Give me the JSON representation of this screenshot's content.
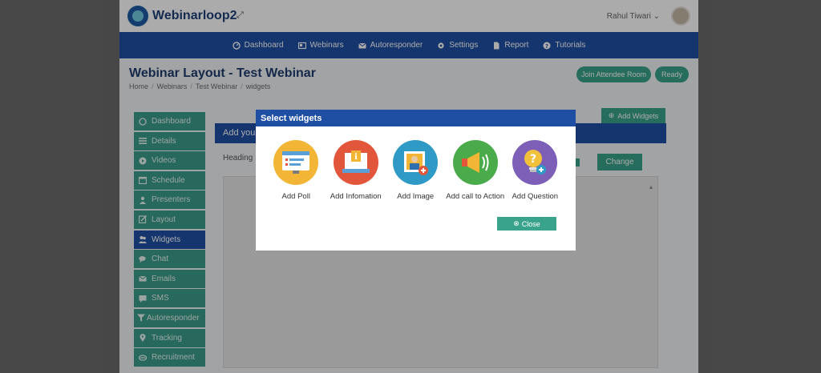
{
  "brand": {
    "name": "Webinarloop2"
  },
  "user": {
    "name": "Rahul Tiwari"
  },
  "nav": {
    "items": [
      {
        "label": "Dashboard",
        "icon": "dashboard-icon"
      },
      {
        "label": "Webinars",
        "icon": "webinars-icon"
      },
      {
        "label": "Autoresponder",
        "icon": "mail-icon"
      },
      {
        "label": "Settings",
        "icon": "gear-icon"
      },
      {
        "label": "Report",
        "icon": "report-icon"
      },
      {
        "label": "Tutorials",
        "icon": "help-icon"
      }
    ]
  },
  "page": {
    "title": "Webinar Layout - Test Webinar",
    "breadcrumb": [
      "Home",
      "Webinars",
      "Test Webinar",
      "widgets"
    ],
    "join_label": "Join Attendee Room",
    "ready_label": "Ready"
  },
  "sidebar": {
    "items": [
      {
        "label": "Dashboard",
        "icon": "dashboard-icon",
        "active": false
      },
      {
        "label": "Details",
        "icon": "list-icon",
        "active": false
      },
      {
        "label": "Videos",
        "icon": "video-icon",
        "active": false
      },
      {
        "label": "Schedule",
        "icon": "calendar-icon",
        "active": false
      },
      {
        "label": "Presenters",
        "icon": "user-icon",
        "active": false
      },
      {
        "label": "Layout",
        "icon": "edit-icon",
        "active": false
      },
      {
        "label": "Widgets",
        "icon": "users-icon",
        "active": true
      },
      {
        "label": "Chat",
        "icon": "chat-icon",
        "active": false
      },
      {
        "label": "Emails",
        "icon": "mail-icon",
        "active": false
      },
      {
        "label": "SMS",
        "icon": "sms-icon",
        "active": false
      },
      {
        "label": "Autoresponder",
        "icon": "filter-icon",
        "active": false
      },
      {
        "label": "Tracking",
        "icon": "pin-icon",
        "active": false
      },
      {
        "label": "Recruitment",
        "icon": "handshake-icon",
        "active": false
      }
    ]
  },
  "content": {
    "bar_label": "Add you",
    "heading_label": "Heading",
    "change_label": "Change",
    "add_widgets_label": "Add Widgets"
  },
  "modal": {
    "title": "Select widgets",
    "close_label": "Close",
    "widgets": [
      {
        "label": "Add Poll",
        "icon": "poll-icon",
        "color": "#f2b535"
      },
      {
        "label": "Add Infomation",
        "icon": "info-icon",
        "color": "#e2573c"
      },
      {
        "label": "Add Image",
        "icon": "image-icon",
        "color": "#2f9ac6"
      },
      {
        "label": "Add call to Action",
        "icon": "megaphone-icon",
        "color": "#4aab4a"
      },
      {
        "label": "Add Question",
        "icon": "question-icon",
        "color": "#7d5fb8"
      }
    ]
  }
}
